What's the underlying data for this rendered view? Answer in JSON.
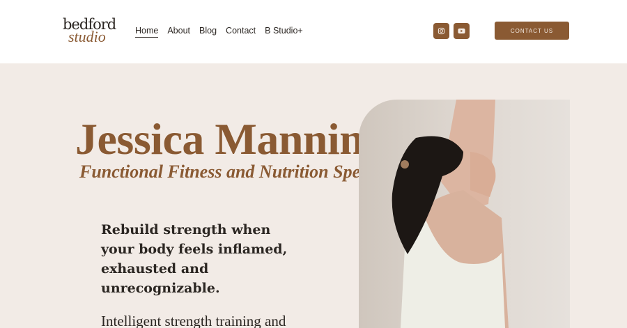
{
  "logo": {
    "line1": "bedford",
    "line2": "studio"
  },
  "nav": {
    "items": [
      "Home",
      "About",
      "Blog",
      "Contact",
      "B Studio+"
    ],
    "active": "Home"
  },
  "social": {
    "instagram_icon": "instagram-icon",
    "youtube_icon": "youtube-icon"
  },
  "header": {
    "contact_label": "CONTACT US"
  },
  "hero": {
    "name": "Jessica Manning,",
    "subtitle": "Functional Fitness and Nutrition Specialist",
    "tagline": "Rebuild strength when your body feels inflamed, exhausted and unrecognizable.",
    "intro": "Intelligent strength training and"
  },
  "colors": {
    "accent": "#8a5a33",
    "background": "#f2ebe6",
    "text": "#2b2622",
    "header_bg": "#ffffff"
  }
}
